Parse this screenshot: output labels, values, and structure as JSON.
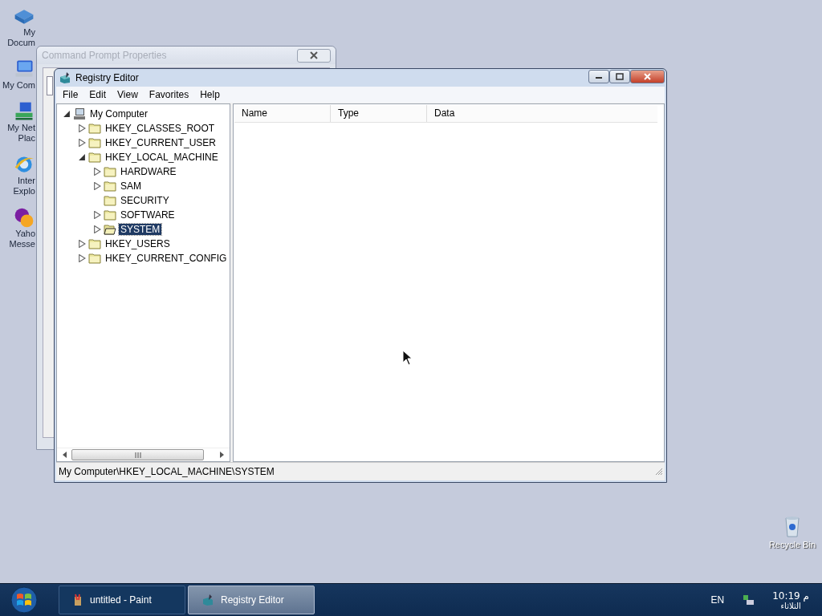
{
  "desktop_icons": [
    {
      "lines": [
        "My",
        "Docum"
      ],
      "kind": "documents"
    },
    {
      "lines": [
        "My Com"
      ],
      "kind": "computer"
    },
    {
      "lines": [
        "My Net",
        "Plac"
      ],
      "kind": "network"
    },
    {
      "lines": [
        "Inter",
        "Explo"
      ],
      "kind": "browser"
    },
    {
      "lines": [
        "Yaho",
        "Messe"
      ],
      "kind": "messenger"
    },
    {
      "lines": [
        "Recycle Bin"
      ],
      "kind": "recycle"
    }
  ],
  "back_window": {
    "title": "Command Prompt Properties"
  },
  "window": {
    "title": "Registry Editor"
  },
  "menu": [
    "File",
    "Edit",
    "View",
    "Favorites",
    "Help"
  ],
  "tree": [
    {
      "label": "My Computer",
      "kind": "computer",
      "expandable": true,
      "expanded": true,
      "selected": false,
      "children": [
        {
          "label": "HKEY_CLASSES_ROOT",
          "kind": "folder",
          "expandable": true,
          "expanded": false,
          "selected": false
        },
        {
          "label": "HKEY_CURRENT_USER",
          "kind": "folder",
          "expandable": true,
          "expanded": false,
          "selected": false
        },
        {
          "label": "HKEY_LOCAL_MACHINE",
          "kind": "folder",
          "expandable": true,
          "expanded": true,
          "selected": false,
          "children": [
            {
              "label": "HARDWARE",
              "kind": "folder",
              "expandable": true,
              "expanded": false,
              "selected": false
            },
            {
              "label": "SAM",
              "kind": "folder",
              "expandable": true,
              "expanded": false,
              "selected": false
            },
            {
              "label": "SECURITY",
              "kind": "folder",
              "expandable": false,
              "selected": false
            },
            {
              "label": "SOFTWARE",
              "kind": "folder",
              "expandable": true,
              "expanded": false,
              "selected": false
            },
            {
              "label": "SYSTEM",
              "kind": "folder",
              "expandable": true,
              "expanded": false,
              "selected": true
            }
          ]
        },
        {
          "label": "HKEY_USERS",
          "kind": "folder",
          "expandable": true,
          "expanded": false,
          "selected": false
        },
        {
          "label": "HKEY_CURRENT_CONFIG",
          "kind": "folder",
          "expandable": true,
          "expanded": false,
          "selected": false
        }
      ]
    }
  ],
  "list": {
    "columns": [
      "Name",
      "Type",
      "Data"
    ]
  },
  "status_bar": "My Computer\\HKEY_LOCAL_MACHINE\\SYSTEM",
  "taskbar": {
    "buttons": [
      {
        "label": "untitled - Paint",
        "kind": "paint",
        "selected": false
      },
      {
        "label": "Registry Editor",
        "kind": "registry",
        "selected": true
      }
    ],
    "language": "EN",
    "time": "10:19 م",
    "day": "الثلاثاء"
  }
}
